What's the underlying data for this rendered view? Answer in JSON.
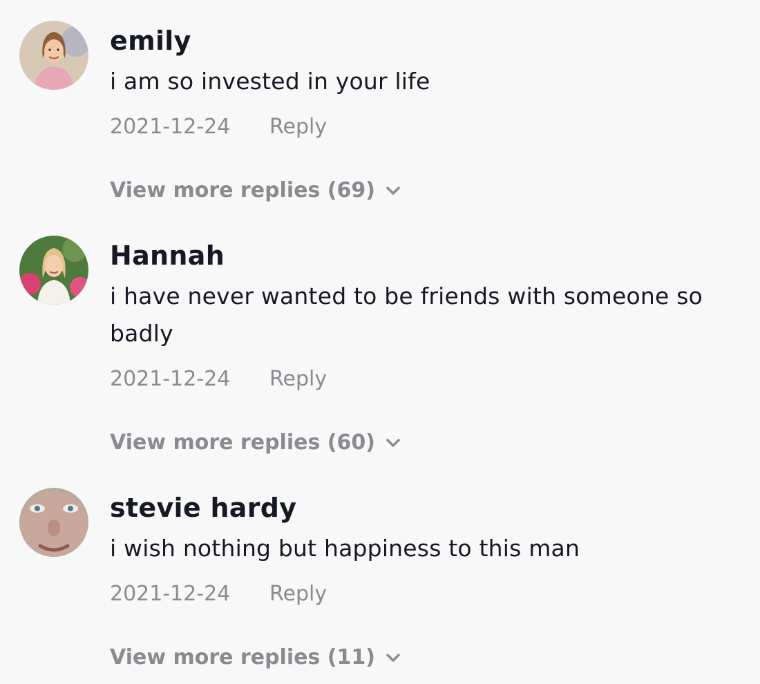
{
  "comments": [
    {
      "username": "emily",
      "text": "i am so invested in your life",
      "date": "2021-12-24",
      "reply_label": "Reply",
      "view_more_label": "View more replies (69)",
      "avatar": "profile-photo-woman-pink-dress"
    },
    {
      "username": "Hannah",
      "text": "i have never wanted to be friends with someone so badly",
      "date": "2021-12-24",
      "reply_label": "Reply",
      "view_more_label": "View more replies (60)",
      "avatar": "profile-photo-woman-garden-flowers"
    },
    {
      "username": "stevie hardy",
      "text": "i wish nothing but happiness to this man",
      "date": "2021-12-24",
      "reply_label": "Reply",
      "view_more_label": "View more replies (11)",
      "avatar": "profile-photo-face-closeup"
    }
  ],
  "icons": {
    "expand": "chevron-down-icon"
  },
  "colors": {
    "background": "#f8f8f8",
    "primary_text": "#161823",
    "secondary_text": "#8a8b91"
  }
}
